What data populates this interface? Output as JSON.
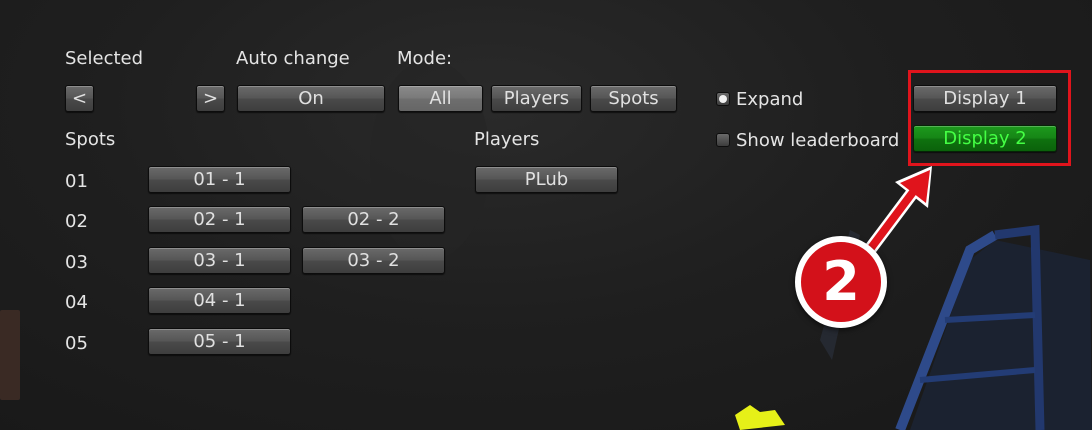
{
  "header": {
    "selected_label": "Selected",
    "auto_change_label": "Auto change",
    "mode_label": "Mode:"
  },
  "controls": {
    "prev": "<",
    "next": ">",
    "auto_change_value": "On",
    "modes": [
      "All",
      "Players",
      "Spots"
    ],
    "active_mode": "All"
  },
  "options": {
    "expand_label": "Expand",
    "expand_checked": true,
    "leaderboard_label": "Show leaderboard",
    "leaderboard_checked": false
  },
  "displays": {
    "display1": "Display 1",
    "display2": "Display 2",
    "active": "Display 2"
  },
  "spots": {
    "header": "Spots",
    "rows": [
      {
        "id": "01",
        "buttons": [
          "01 - 1"
        ]
      },
      {
        "id": "02",
        "buttons": [
          "02 - 1",
          "02 - 2"
        ]
      },
      {
        "id": "03",
        "buttons": [
          "03 - 1",
          "03 - 2"
        ]
      },
      {
        "id": "04",
        "buttons": [
          "04 - 1"
        ]
      },
      {
        "id": "05",
        "buttons": [
          "05 - 1"
        ]
      }
    ]
  },
  "players": {
    "header": "Players",
    "items": [
      "PLub"
    ]
  },
  "annotation": {
    "step_number": "2",
    "highlight_color": "#e0141c",
    "arrow_color": "#e0141c"
  }
}
